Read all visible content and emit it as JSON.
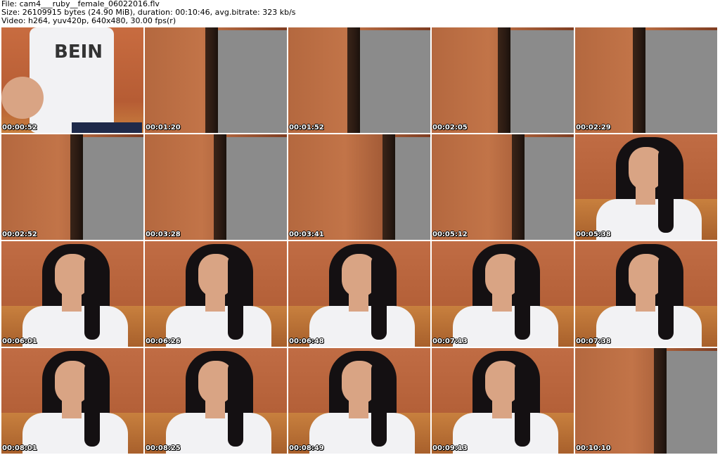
{
  "header": {
    "line1": "File: cam4___ruby__female_06022016.flv",
    "line2": "Size: 26109915 bytes (24.90 MiB), duration: 00:10:46, avg.bitrate: 323 kb/s",
    "line3": "Video: h264, yuv420p, 640x480, 30.00 fps(r)"
  },
  "thumbnails": [
    {
      "timestamp": "00:00:52",
      "scene": "person-torso-shirt",
      "shirt_text": "BEIN"
    },
    {
      "timestamp": "00:01:20",
      "scene": "wall-gray-panel"
    },
    {
      "timestamp": "00:01:52",
      "scene": "wall-gray-panel"
    },
    {
      "timestamp": "00:02:05",
      "scene": "wall-gray-panel"
    },
    {
      "timestamp": "00:02:29",
      "scene": "wall-gray-panel"
    },
    {
      "timestamp": "00:02:52",
      "scene": "wall-gray-panel"
    },
    {
      "timestamp": "00:03:28",
      "scene": "wall-gray-panel"
    },
    {
      "timestamp": "00:03:41",
      "scene": "wall-gray-panel"
    },
    {
      "timestamp": "00:05:12",
      "scene": "wall-gray-panel"
    },
    {
      "timestamp": "00:05:38",
      "scene": "person-seated"
    },
    {
      "timestamp": "00:06:01",
      "scene": "person-seated"
    },
    {
      "timestamp": "00:06:26",
      "scene": "person-seated"
    },
    {
      "timestamp": "00:06:48",
      "scene": "person-seated"
    },
    {
      "timestamp": "00:07:13",
      "scene": "person-seated"
    },
    {
      "timestamp": "00:07:38",
      "scene": "person-seated"
    },
    {
      "timestamp": "00:08:01",
      "scene": "person-seated"
    },
    {
      "timestamp": "00:08:25",
      "scene": "person-seated"
    },
    {
      "timestamp": "00:08:49",
      "scene": "person-seated"
    },
    {
      "timestamp": "00:09:13",
      "scene": "person-seated"
    },
    {
      "timestamp": "00:10:10",
      "scene": "wall-gray-panel"
    }
  ],
  "colors": {
    "wall": "#b4683f",
    "wall_dark": "#7e3d22",
    "panel_gray": "#8b8b8b",
    "door_dark": "#2a1a12",
    "sofa": "#c8803e",
    "hair": "#141012",
    "skin": "#d9a484",
    "shirt": "#f2f2f4"
  }
}
